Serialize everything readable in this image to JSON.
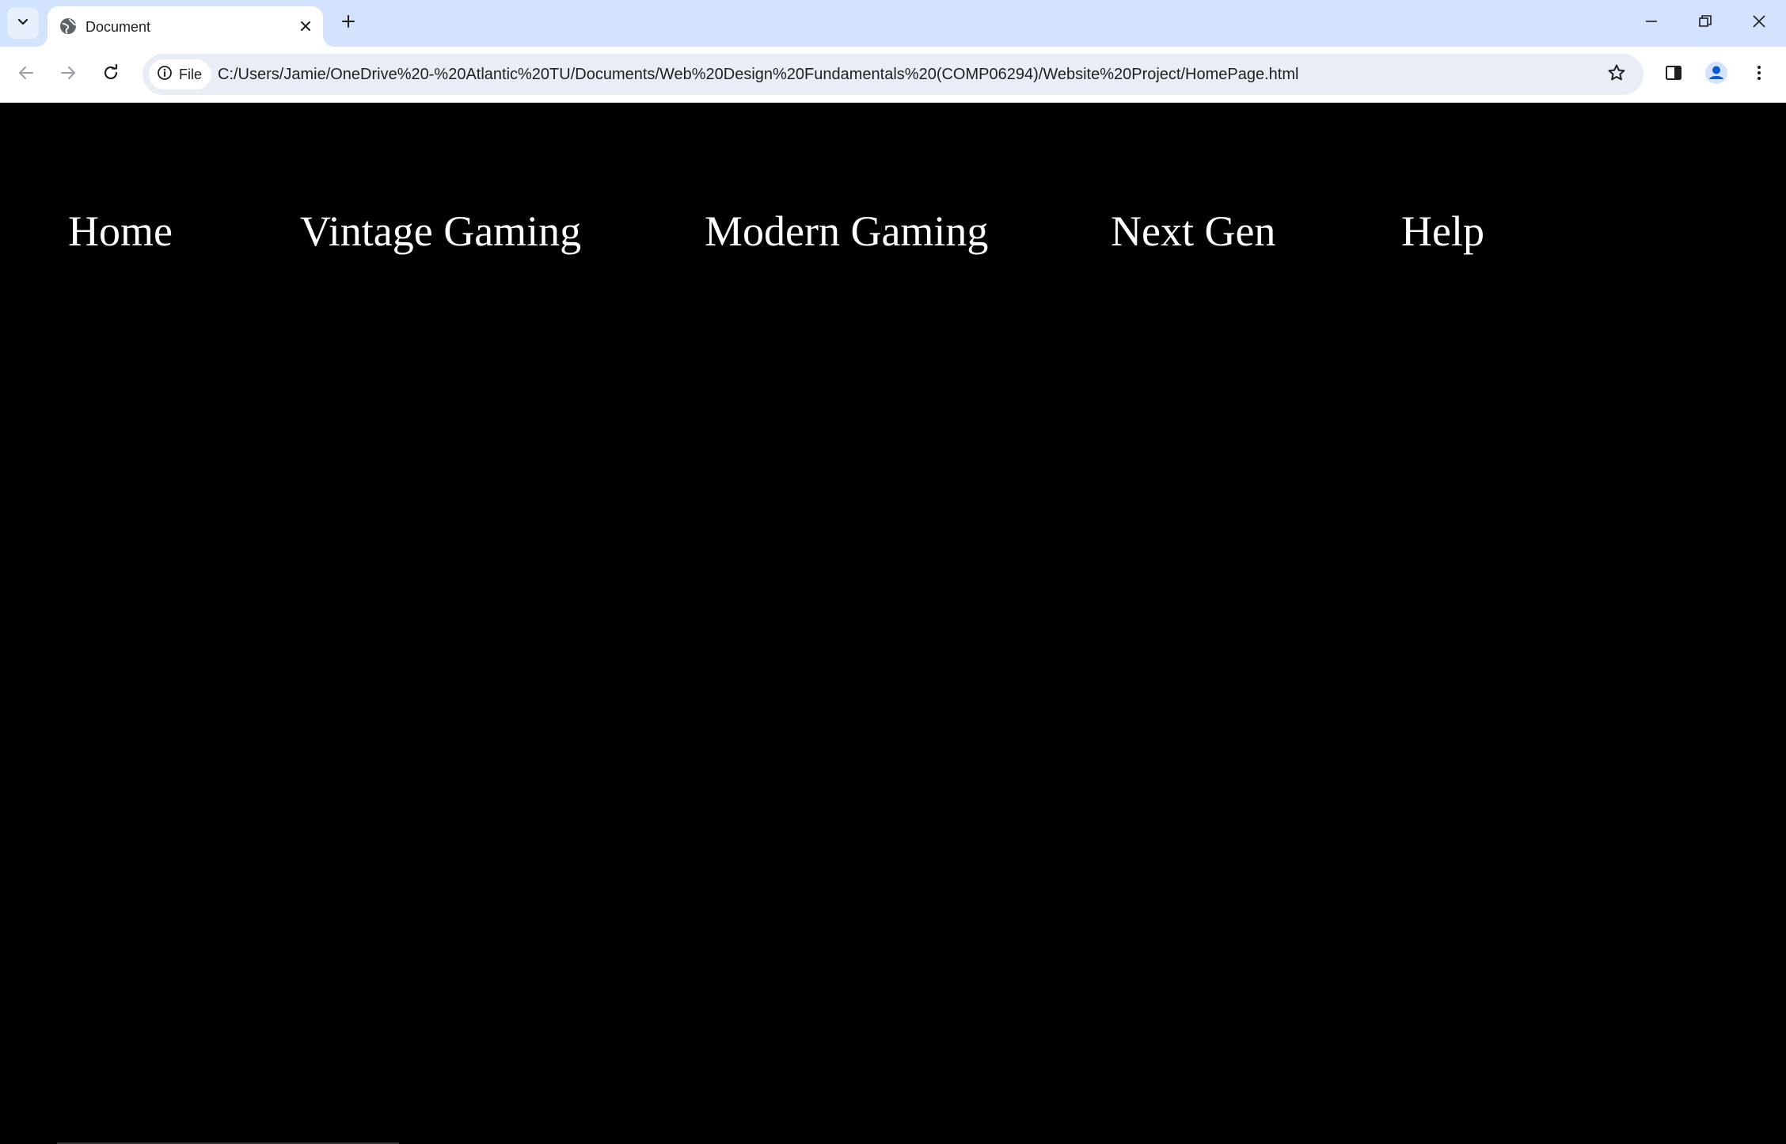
{
  "browser": {
    "tab": {
      "title": "Document",
      "favicon": "globe-icon"
    },
    "new_tab_icon": "plus-icon",
    "address_bar": {
      "site_info_label": "File",
      "url": "C:/Users/Jamie/OneDrive%20-%20Atlantic%20TU/Documents/Web%20Design%20Fundamentals%20(COMP06294)/Website%20Project/HomePage.html"
    },
    "toolbar_icons": [
      "back-arrow-icon",
      "forward-arrow-icon",
      "reload-icon",
      "star-icon",
      "side-panel-icon",
      "profile-icon",
      "more-vert-icon"
    ],
    "window_controls": [
      "minimize-icon",
      "restore-icon",
      "close-icon"
    ]
  },
  "page": {
    "nav": [
      {
        "label": "Home"
      },
      {
        "label": "Vintage Gaming"
      },
      {
        "label": "Modern Gaming"
      },
      {
        "label": "Next Gen"
      },
      {
        "label": "Help"
      }
    ]
  },
  "colors": {
    "tabstrip_bg": "#d3e3fd",
    "page_bg": "#000000",
    "nav_text": "#ffffff",
    "omnibox_bg": "#e9eef6"
  }
}
